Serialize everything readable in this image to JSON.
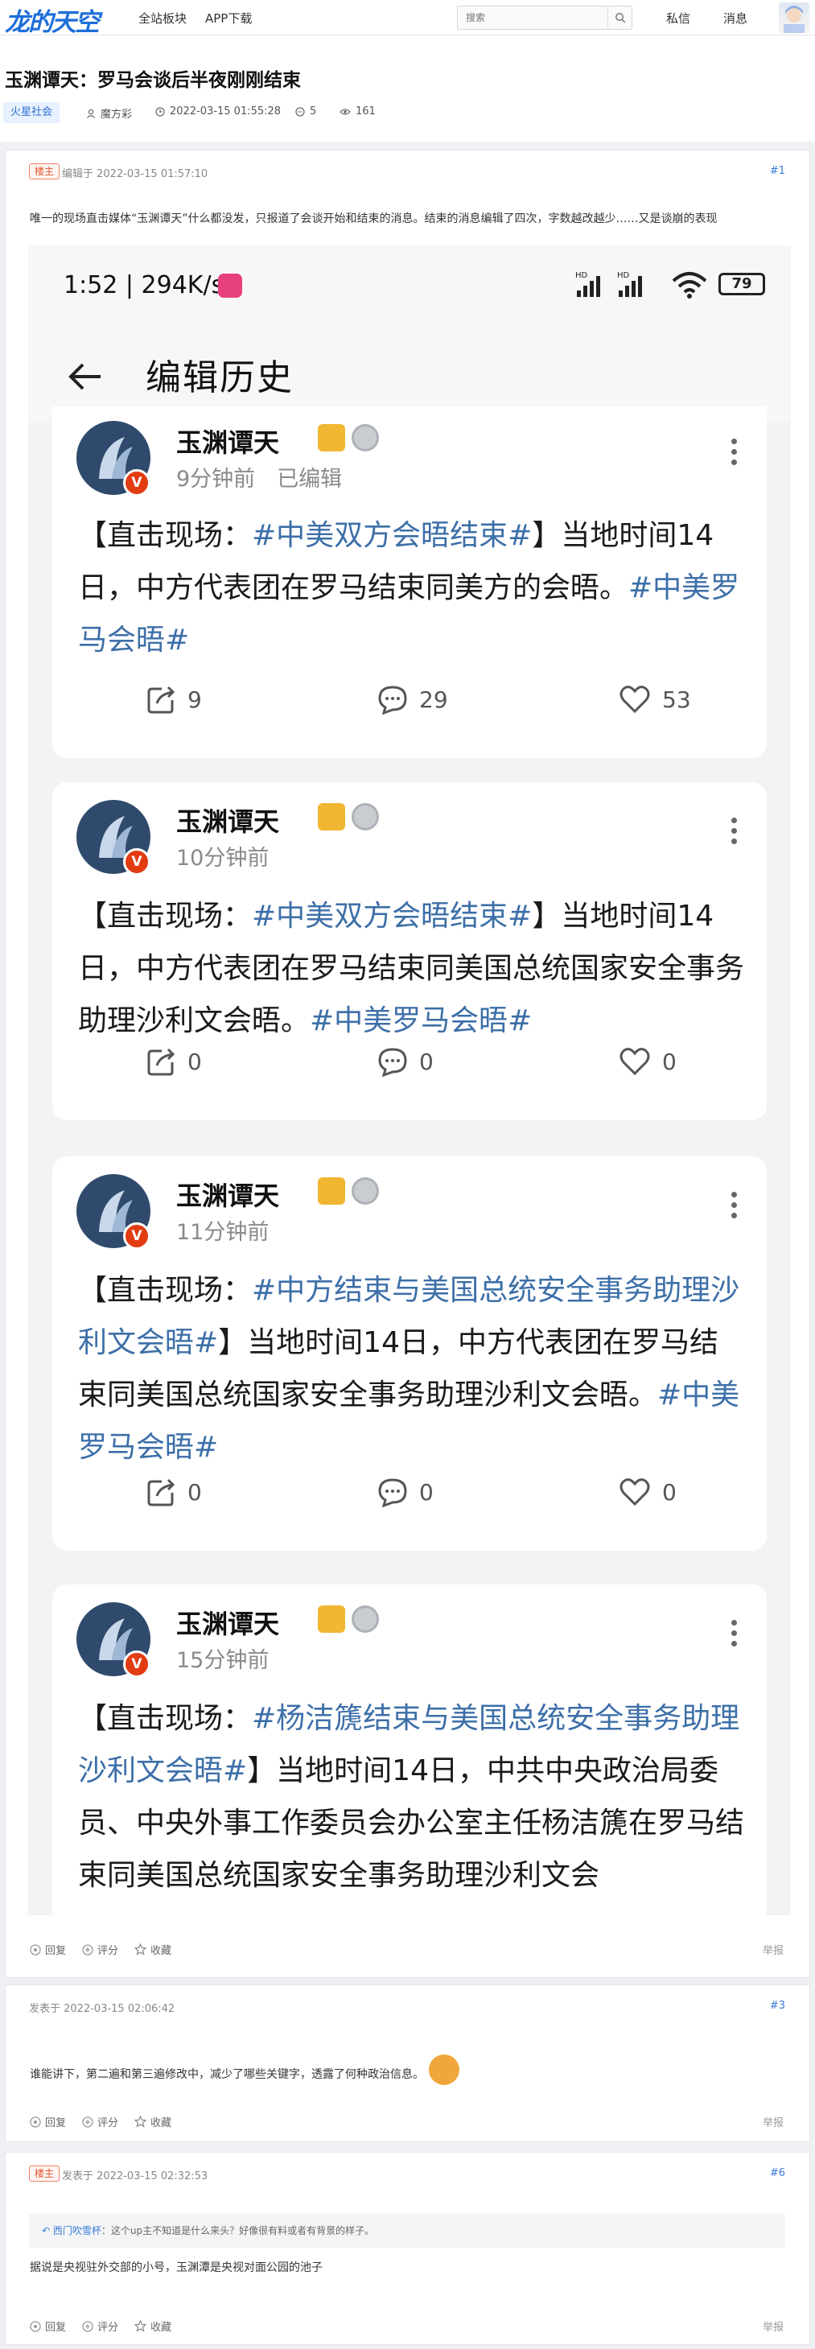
{
  "header": {
    "logo": "龙的天空",
    "nav": [
      "全站板块",
      "APP下载"
    ],
    "search_placeholder": "搜索",
    "messages_private": "私信",
    "messages": "消息"
  },
  "thread": {
    "title": "玉渊谭天：罗马会谈后半夜刚刚结束",
    "tag": "火星社会",
    "author": "魔方彩",
    "datetime": "2022-03-15 01:55:28",
    "replies": "5",
    "views": "161"
  },
  "posts": [
    {
      "louzhu": "楼主",
      "time_label": "编辑于 2022-03-15 01:57:10",
      "floor": "#1",
      "text": "唯一的现场直击媒体“玉渊谭天”什么都没发，只报道了会谈开始和结束的消息。结束的消息编辑了四次，字数越改越少……又是谈崩的表现",
      "actions": [
        "回复",
        "评分",
        "收藏"
      ],
      "report": "举报"
    },
    {
      "louzhu": "",
      "time_label": "发表于 2022-03-15 02:06:42",
      "floor": "#3",
      "text": "谁能讲下，第二遍和第三遍修改中，减少了哪些关键字，透露了何种政治信息。",
      "actions": [
        "回复",
        "评分",
        "收藏"
      ],
      "report": "举报"
    },
    {
      "louzhu": "楼主",
      "time_label": "发表于 2022-03-15 02:32:53",
      "floor": "#6",
      "quote_user": "西门吹雪杯",
      "quote_text": "这个up主不知道是什么来头？好像很有料或者有背景的样子。",
      "text": "据说是央视驻外交部的小号，玉渊潭是央视对面公园的池子",
      "actions": [
        "回复",
        "评分",
        "收藏"
      ],
      "report": "举报"
    }
  ],
  "screenshot": {
    "status_time": "1:52 | 294K/s",
    "battery": "79",
    "appbar_title": "编辑历史",
    "cards": [
      {
        "name": "玉渊谭天",
        "time": "9分钟前",
        "edited": "已编辑",
        "pre": "【直击现场：",
        "topic1": "#中美双方会晤结束#",
        "mid": "】当地时间14日，中方代表团在罗马结束同美方的会晤。",
        "topic2": "#中美罗马会晤#",
        "reposts": "9",
        "comments": "29",
        "likes": "53"
      },
      {
        "name": "玉渊谭天",
        "time": "10分钟前",
        "edited": "",
        "pre": "【直击现场：",
        "topic1": "#中美双方会晤结束#",
        "mid": "】当地时间14日，中方代表团在罗马结束同美国总统国家安全事务助理沙利文会晤。",
        "topic2": "#中美罗马会晤#",
        "reposts": "0",
        "comments": "0",
        "likes": "0"
      },
      {
        "name": "玉渊谭天",
        "time": "11分钟前",
        "edited": "",
        "pre": "【直击现场：",
        "topic1": "#中方结束与美国总统安全事务助理沙利文会晤#",
        "mid": "】当地时间14日，中方代表团在罗马结束同美国总统国家安全事务助理沙利文会晤。",
        "topic2": "#中美罗马会晤#",
        "reposts": "0",
        "comments": "0",
        "likes": "0"
      },
      {
        "name": "玉渊谭天",
        "time": "15分钟前",
        "edited": "",
        "pre": "【直击现场：",
        "topic1": "#杨洁篪结束与美国总统安全事务助理沙利文会晤#",
        "mid": "】当地时间14日，中共中央政治局委员、中央外事工作委员会办公室主任杨洁篪在罗马结束同美国总统国家安全事务助理沙利文会",
        "topic2": "",
        "reposts": "",
        "comments": "",
        "likes": ""
      }
    ]
  },
  "colors": {
    "accent": "#1e6fd9",
    "topic": "#3d6fa8",
    "louzhu": "#e6552f"
  }
}
